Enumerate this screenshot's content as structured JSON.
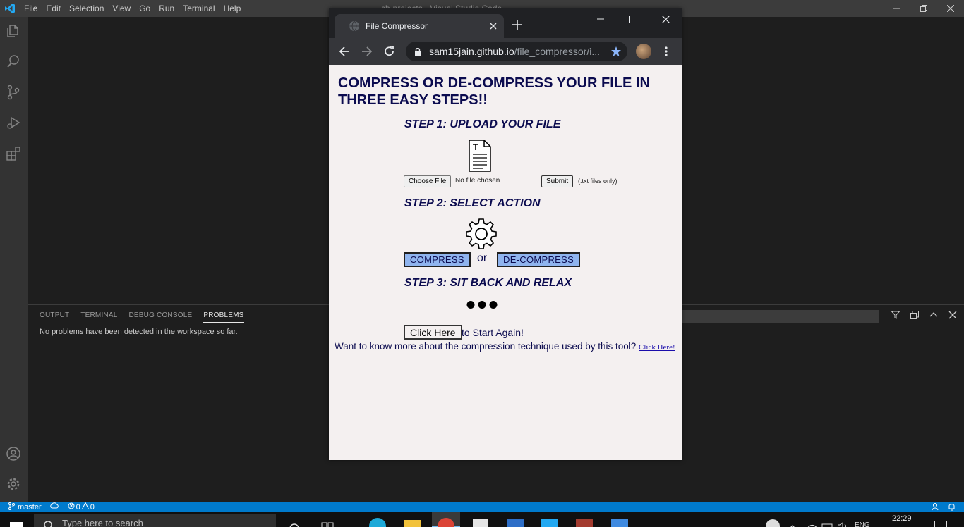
{
  "vscode": {
    "title": "cb-projects - Visual Studio Code",
    "menu": [
      "File",
      "Edit",
      "Selection",
      "View",
      "Go",
      "Run",
      "Terminal",
      "Help"
    ],
    "panel": {
      "tabs": [
        "OUTPUT",
        "TERMINAL",
        "DEBUG CONSOLE",
        "PROBLEMS"
      ],
      "active_tab": "PROBLEMS",
      "message": "No problems have been detected in the workspace so far."
    },
    "status": {
      "branch": "master",
      "errors": "0",
      "warnings": "0"
    }
  },
  "chrome": {
    "tab_title": "File Compressor",
    "url_host": "sam15jain.github.io",
    "url_path": "/file_compressor/i..."
  },
  "page": {
    "heading": "COMPRESS OR DE-COMPRESS YOUR FILE IN THREE EASY STEPS!!",
    "step1": "STEP 1: UPLOAD YOUR FILE",
    "choose_file": "Choose File",
    "no_file": "No file chosen",
    "submit": "Submit",
    "file_hint": "(.txt files only)",
    "step2": "STEP 2: SELECT  ACTION",
    "compress": "COMPRESS",
    "or": "or",
    "decompress": "DE-COMPRESS",
    "step3": "STEP 3: SIT BACK AND RELAX",
    "click_here": "Click Here",
    "restart": "to Start Again!",
    "more_info": "Want to know more about the compression technique used by this tool?",
    "more_link": "Click Here!"
  },
  "taskbar": {
    "search_placeholder": "Type here to search",
    "language": "ENG",
    "time": "22:29"
  }
}
